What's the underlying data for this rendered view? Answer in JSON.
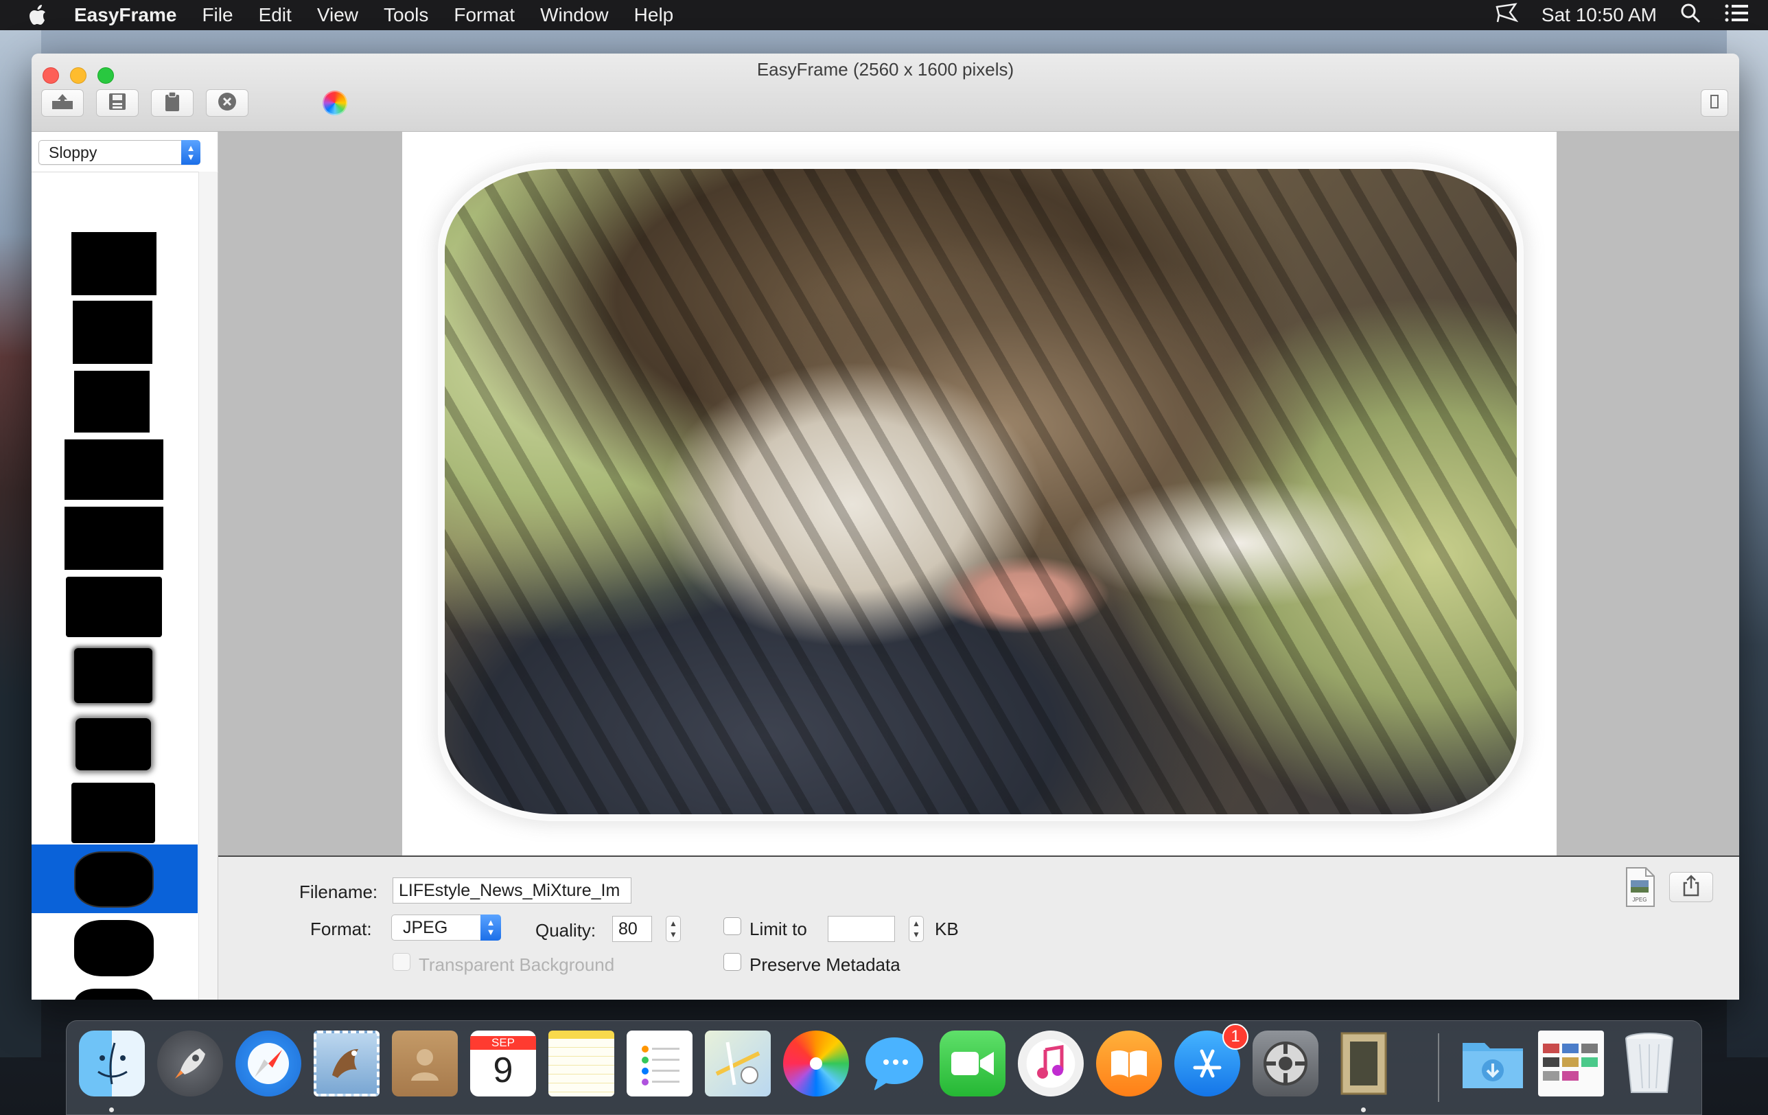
{
  "menubar": {
    "app_name": "EasyFrame",
    "items": [
      "File",
      "Edit",
      "View",
      "Tools",
      "Format",
      "Window",
      "Help"
    ],
    "clock": "Sat 10:50 AM"
  },
  "window": {
    "title": "EasyFrame (2560 x 1600 pixels)",
    "toolbar": {
      "buttons": [
        "open-icon",
        "save-icon",
        "clipboard-icon",
        "close-icon"
      ],
      "color_wheel": "color-wheel-icon",
      "right_button": "sidebar-toggle-icon"
    }
  },
  "sidebar": {
    "style_select": "Sloppy",
    "selected_index": 9,
    "accent_color": "#0a62d9"
  },
  "bottom_panel": {
    "filename_label": "Filename:",
    "filename_value": "LIFEstyle_News_MiXture_Im",
    "format_label": "Format:",
    "format_value": "JPEG",
    "quality_label": "Quality:",
    "quality_value": "80",
    "limit_label": "Limit to",
    "limit_value": "",
    "kb_label": "KB",
    "transparent_label": "Transparent Background",
    "preserve_label": "Preserve Metadata",
    "jpeg_icon_text": "JPEG"
  },
  "dock": {
    "apps": [
      "finder",
      "launchpad",
      "safari",
      "mail",
      "contacts",
      "calendar",
      "notes",
      "reminders",
      "maps",
      "photos",
      "messages",
      "facetime",
      "itunes",
      "ibooks",
      "app-store",
      "system-preferences",
      "easyframe",
      "downloads",
      "preview-stack",
      "trash"
    ],
    "calendar_month": "SEP",
    "calendar_day": "9",
    "app_store_badge": "1"
  }
}
